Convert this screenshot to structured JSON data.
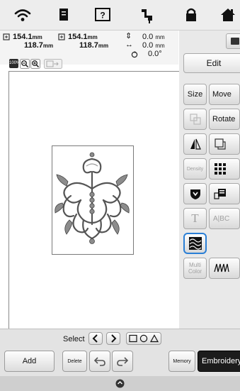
{
  "status_bar": {
    "icons": [
      "wifi-icon",
      "document-icon",
      "help-icon",
      "needle-icon",
      "lock-icon",
      "home-icon"
    ]
  },
  "info": {
    "width1": "154.1",
    "height1": "118.7",
    "width2": "154.1",
    "height2": "118.7",
    "unit": "mm",
    "v_offset": "0.0",
    "h_offset": "0.0",
    "angle": "0.0°",
    "zoom_label": "100%"
  },
  "panel": {
    "edit_tab": "Edit",
    "size": "Size",
    "move": "Move",
    "rotate": "Rotate",
    "density": "Density",
    "text_icon": "T",
    "abc": "A|BC",
    "multi_color": "Multi Color"
  },
  "bottom": {
    "select_label": "Select",
    "add": "Add",
    "delete": "Delete",
    "memory": "Memory",
    "embroidery": "Embroidery"
  },
  "colors": {
    "accent_blue": "#2a7fd6",
    "dark_button": "#1c1c1c"
  }
}
